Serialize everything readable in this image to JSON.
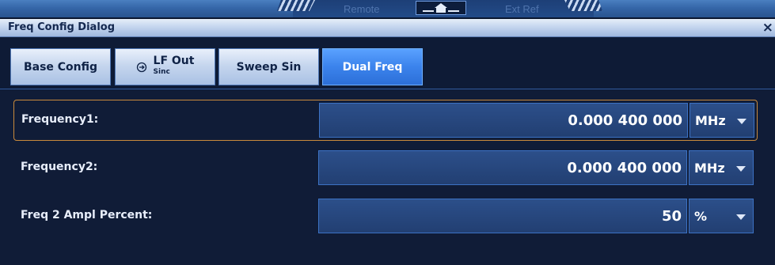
{
  "status": {
    "remote_label": "Remote",
    "ext_ref_label": "Ext Ref",
    "home_icon": "home-icon"
  },
  "dialog": {
    "title": "Freq Config Dialog",
    "close_label": "×"
  },
  "tabs": [
    {
      "label": "Base Config",
      "active": false
    },
    {
      "label": "LF Out",
      "sub": "Sinc",
      "icon": "arrow-circle-icon",
      "active": false
    },
    {
      "label": "Sweep Sin",
      "active": false
    },
    {
      "label": "Dual Freq",
      "active": true
    }
  ],
  "fields": [
    {
      "label": "Frequency1:",
      "value": "0.000 400 000",
      "unit": "MHz",
      "selected": true
    },
    {
      "label": "Frequency2:",
      "value": "0.000 400 000",
      "unit": "MHz",
      "selected": false
    },
    {
      "label": "Freq 2 Ampl Percent:",
      "value": "50",
      "unit": "%",
      "selected": false
    }
  ],
  "colors": {
    "accent": "#3b83ec",
    "selection_border": "#c98a3c",
    "background": "#101c37"
  }
}
